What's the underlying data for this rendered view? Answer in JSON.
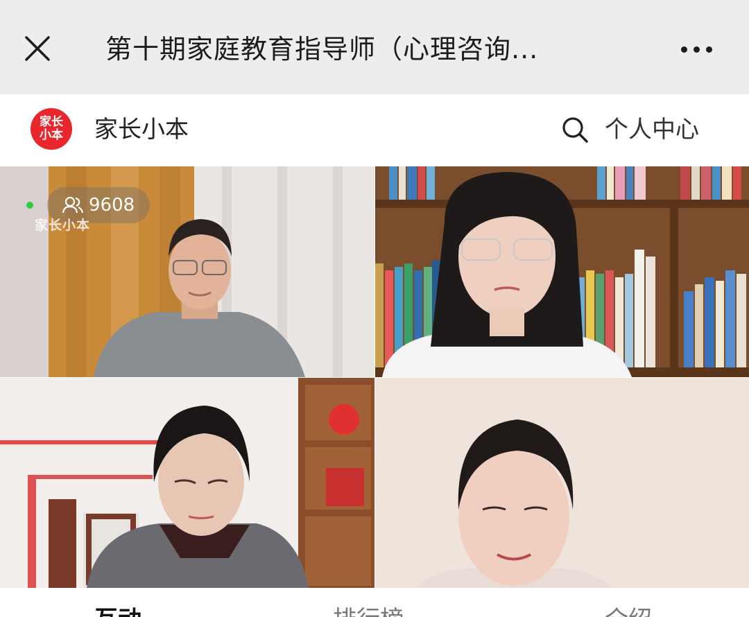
{
  "titlebar": {
    "title": "第十期家庭教育指导师（心理咨询..."
  },
  "header": {
    "brand_logo_text": [
      "家长",
      "小本"
    ],
    "brand_name": "家长小本",
    "profile_label": "个人中心"
  },
  "live": {
    "viewer_count": "9608",
    "watermark": "家长小本"
  },
  "tabs": [
    {
      "label": "互动",
      "active": true
    },
    {
      "label": "排行榜",
      "active": false
    },
    {
      "label": "介绍",
      "active": false
    }
  ],
  "colors": {
    "brand_red": "#e8262b",
    "live_green": "#2ecc40",
    "titlebar_bg": "#ededed"
  }
}
